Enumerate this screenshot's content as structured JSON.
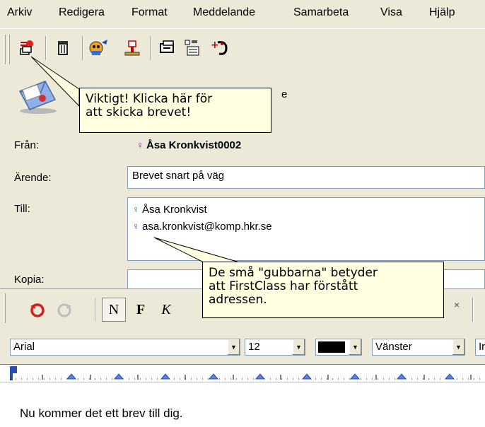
{
  "menubar": {
    "items": [
      "Arkiv",
      "Redigera",
      "Format",
      "Meddelande",
      "Samarbeta",
      "Visa",
      "Hjälp"
    ]
  },
  "toolbar": {
    "buttons": [
      "send-icon",
      "trash-icon",
      "address-book-icon",
      "user-icon",
      "print-icon",
      "forward-icon",
      "add-phone-icon"
    ]
  },
  "header": {
    "subject_partial": "e",
    "from_label": "Från:",
    "from_value": "Åsa Kronkvist0002",
    "subject_label": "Ärende:",
    "subject_value": "Brevet snart på väg",
    "to_label": "Till:",
    "to_recipients": [
      "Åsa Kronkvist",
      "asa.kronkvist@komp.hkr.se"
    ],
    "cc_label": "Kopia:"
  },
  "format_toolbar": {
    "bold": "F",
    "normal": "N",
    "italic": "K",
    "font_name": "Arial",
    "font_size": "12",
    "align": "Vänster",
    "extra": "Ir"
  },
  "body": {
    "text": "Nu kommer det ett brev till dig."
  },
  "tooltips": {
    "send_tip_line1": "Viktigt! Klicka här för",
    "send_tip_line2": "att skicka brevet!",
    "address_tip_line1": "De små \"gubbarna\" betyder",
    "address_tip_line2": "att FirstClass har förstått",
    "address_tip_line3": "adressen."
  },
  "colors": {
    "chrome": "#ece9d8",
    "tooltip": "#ffffe1",
    "person_green": "#2b8a2b",
    "person_purple": "#7b2fa8"
  }
}
